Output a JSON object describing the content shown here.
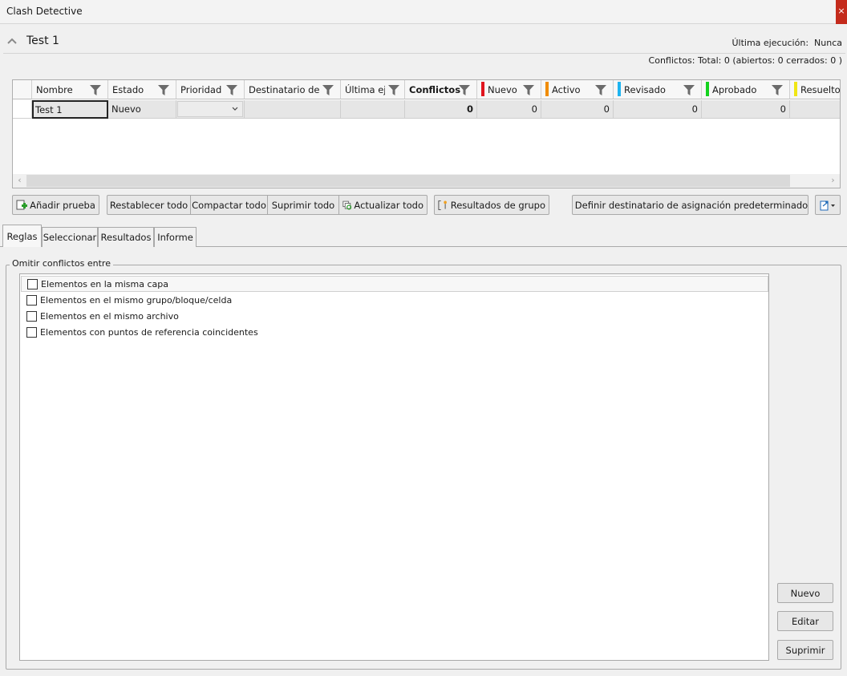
{
  "window": {
    "title": "Clash Detective",
    "close_glyph": "×"
  },
  "header": {
    "test_name": "Test 1",
    "last_run_label": "Última ejecución:",
    "last_run_value": "Nunca",
    "conflicts_summary": "Conflictos:  Total:  0  (abiertos:  0  cerrados:  0 )"
  },
  "grid": {
    "columns": [
      {
        "label": "Nombre",
        "filter": true
      },
      {
        "label": "Estado",
        "filter": true
      },
      {
        "label": "Prioridad",
        "filter": true
      },
      {
        "label": "Destinatario de a",
        "filter": true
      },
      {
        "label": "Última eje",
        "filter": true
      },
      {
        "label": "Conflictos",
        "filter": true,
        "bold": true
      },
      {
        "label": "Nuevo",
        "filter": true,
        "color": "#e0141e"
      },
      {
        "label": "Activo",
        "filter": true,
        "color": "#f08c00"
      },
      {
        "label": "Revisado",
        "filter": true,
        "color": "#1eb4f0"
      },
      {
        "label": "Aprobado",
        "filter": true,
        "color": "#14d21e"
      },
      {
        "label": "Resuelto",
        "filter": false,
        "color": "#f0e614"
      }
    ],
    "rows": [
      {
        "name": "Test 1",
        "status": "Nuevo",
        "priority": "",
        "assignee": "",
        "last_run": "",
        "conflicts": "0",
        "new": "0",
        "active": "0",
        "reviewed": "0",
        "approved": "0",
        "resolved": ""
      }
    ]
  },
  "toolbar": {
    "add_test": "Añadir prueba",
    "reset_all": "Restablecer todo",
    "compact_all": "Compactar todo",
    "delete_all": "Suprimir todo",
    "update_all": "Actualizar todo",
    "group_results": "Resultados de grupo",
    "set_default_assignee": "Definir destinatario de asignación predeterminado"
  },
  "tabs": [
    "Reglas",
    "Seleccionar",
    "Resultados",
    "Informe"
  ],
  "rules_panel": {
    "group_title": "Omitir conflictos entre",
    "rules": [
      {
        "label": "Elementos en la misma capa",
        "checked": false
      },
      {
        "label": "Elementos en el mismo grupo/bloque/celda",
        "checked": false
      },
      {
        "label": "Elementos en el mismo archivo",
        "checked": false
      },
      {
        "label": "Elementos con puntos de referencia coincidentes",
        "checked": false
      }
    ],
    "new_button": "Nuevo",
    "edit_button": "Editar",
    "delete_button": "Suprimir"
  }
}
